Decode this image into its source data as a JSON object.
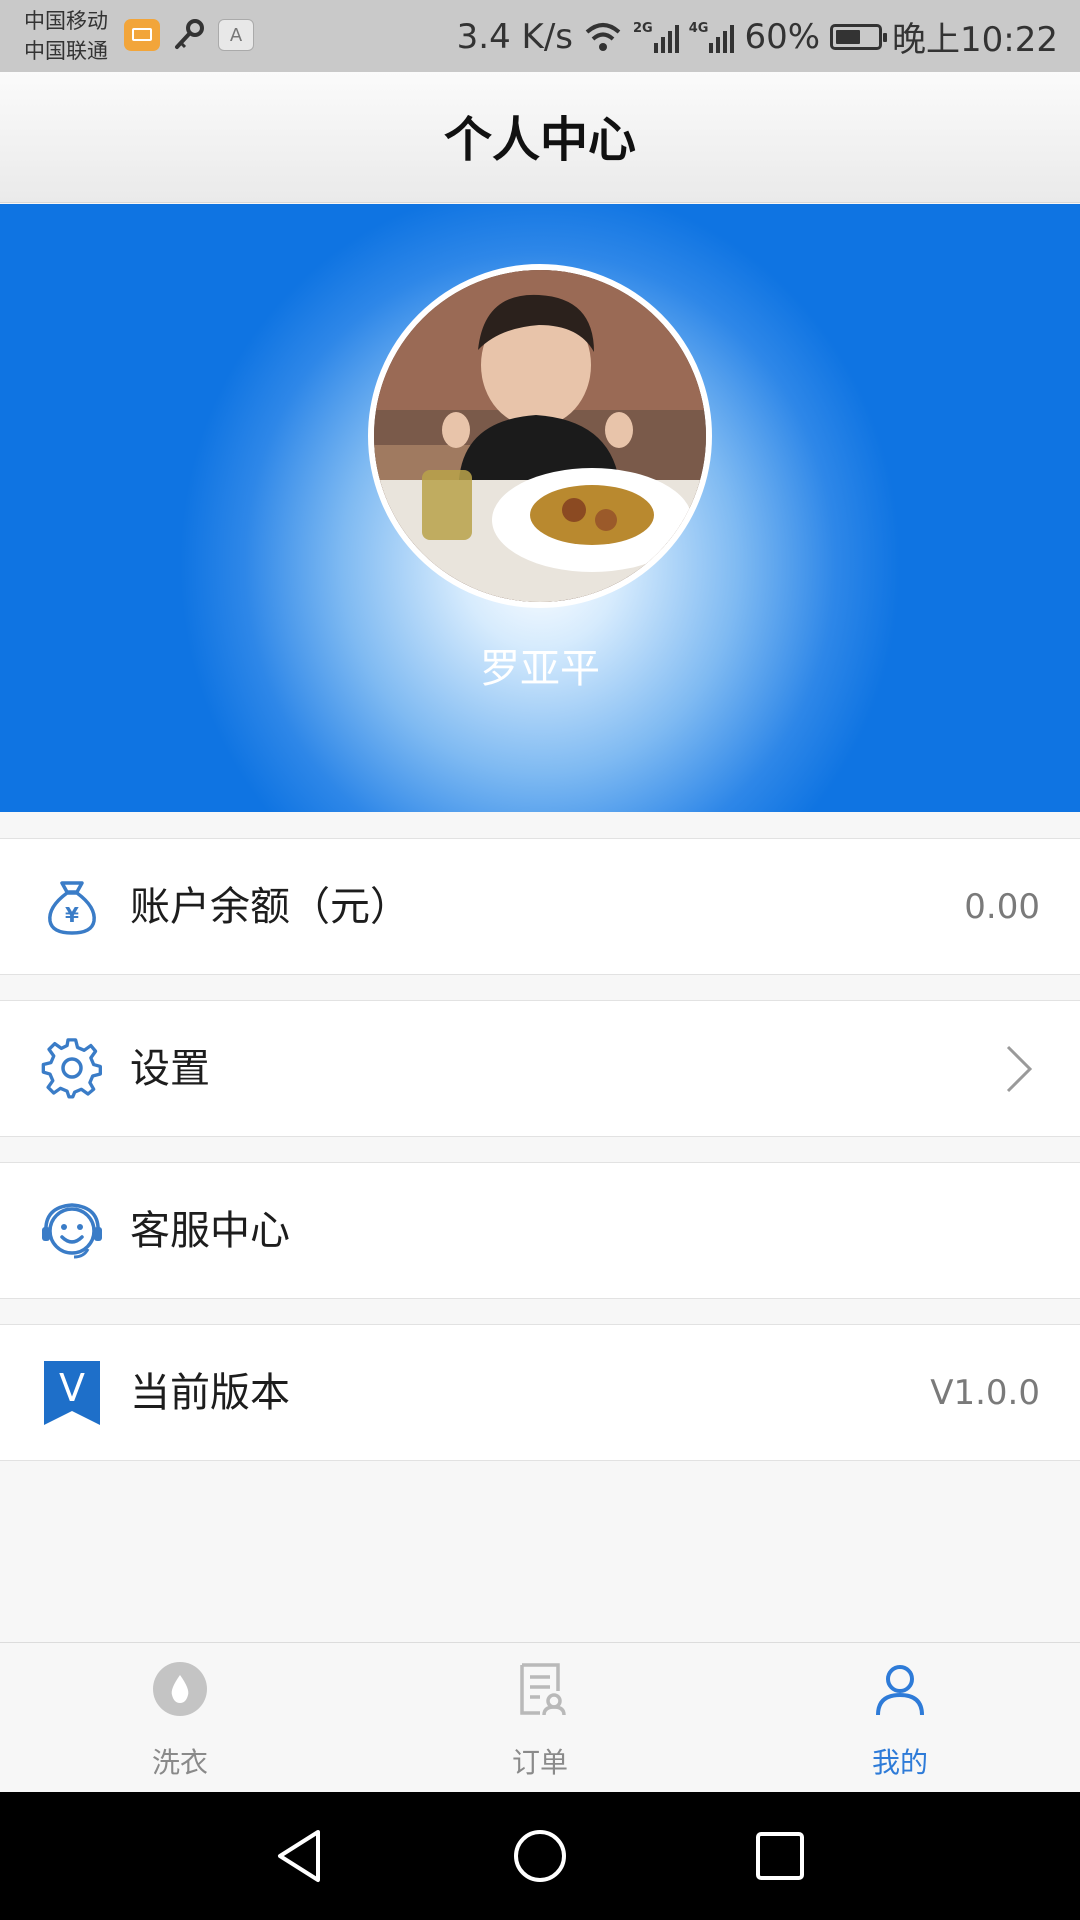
{
  "status_bar": {
    "carrier1": "中国移动",
    "carrier2": "中国联通",
    "a_label": "A",
    "speed": "3.4 K/s",
    "net1": "2G",
    "net2": "4G",
    "battery": "60%",
    "battery_level": 0.6,
    "time": "晚上10:22"
  },
  "header": {
    "title": "个人中心"
  },
  "profile": {
    "username": "罗亚平"
  },
  "menu": {
    "balance": {
      "label": "账户余额（元）",
      "value": "0.00",
      "icon": "money-bag-icon"
    },
    "settings": {
      "label": "设置",
      "icon": "gear-icon"
    },
    "service": {
      "label": "客服中心",
      "icon": "headset-smile-icon"
    },
    "version": {
      "label": "当前版本",
      "value": "V1.0.0",
      "icon": "version-badge-icon",
      "badge_letter": "V"
    }
  },
  "tabs": [
    {
      "label": "洗衣",
      "icon": "water-drop-icon",
      "active": false
    },
    {
      "label": "订单",
      "icon": "order-doc-icon",
      "active": false
    },
    {
      "label": "我的",
      "icon": "person-icon",
      "active": true
    }
  ],
  "colors": {
    "accent": "#2e7bd8",
    "hero_blue": "#0f74e2",
    "icon_blue": "#3a7cc7"
  }
}
